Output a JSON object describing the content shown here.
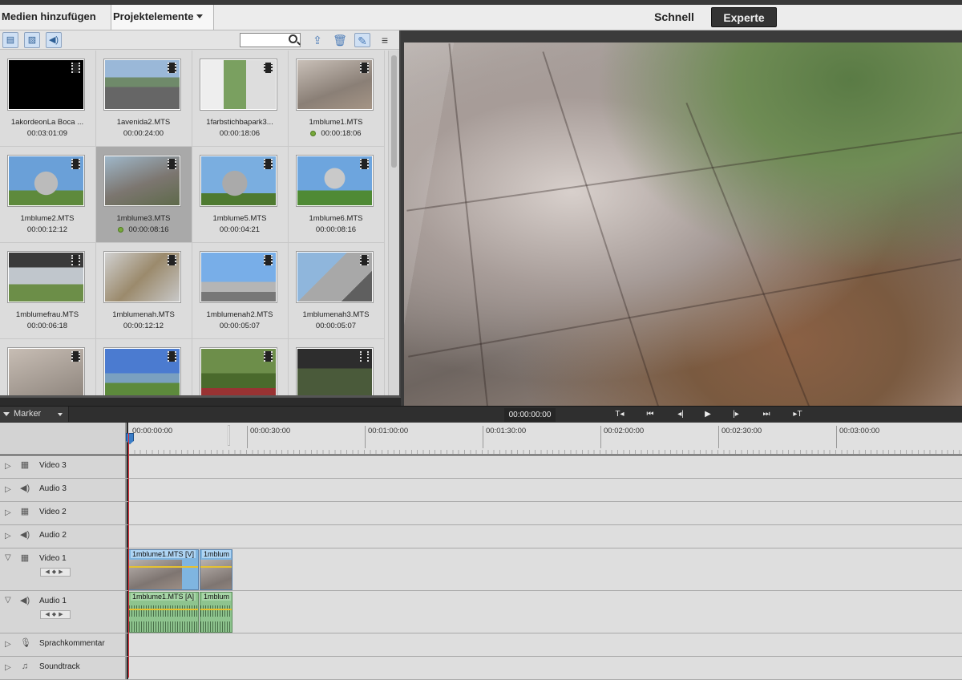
{
  "topbar": {
    "media_menu": "Medien hinzufügen",
    "project_menu": "Projektelemente",
    "mode_quick": "Schnell",
    "mode_expert": "Experte"
  },
  "assets": {
    "toolbar": {
      "filter_video": "video-filter-icon",
      "filter_image": "image-filter-icon",
      "filter_audio": "audio-filter-icon",
      "search_placeholder": ""
    },
    "items": [
      {
        "name": "1akordeonLa Boca ...",
        "duration": "00:03:01:09",
        "used": false
      },
      {
        "name": "1avenida2.MTS",
        "duration": "00:00:24:00",
        "used": false
      },
      {
        "name": "1farbstichbapark3...",
        "duration": "00:00:18:06",
        "used": false
      },
      {
        "name": "1mblume1.MTS",
        "duration": "00:00:18:06",
        "used": true
      },
      {
        "name": "1mblume2.MTS",
        "duration": "00:00:12:12",
        "used": false
      },
      {
        "name": "1mblume3.MTS",
        "duration": "00:00:08:16",
        "used": true
      },
      {
        "name": "1mblume5.MTS",
        "duration": "00:00:04:21",
        "used": false
      },
      {
        "name": "1mblume6.MTS",
        "duration": "00:00:08:16",
        "used": false
      },
      {
        "name": "1mblumefrau.MTS",
        "duration": "00:00:06:18",
        "used": false
      },
      {
        "name": "1mblumenah.MTS",
        "duration": "00:00:12:12",
        "used": false
      },
      {
        "name": "1mblumenah2.MTS",
        "duration": "00:00:05:07",
        "used": false
      },
      {
        "name": "1mblumenah3.MTS",
        "duration": "00:00:05:07",
        "used": false
      },
      {
        "name": "",
        "duration": "",
        "used": false
      },
      {
        "name": "",
        "duration": "",
        "used": false
      },
      {
        "name": "",
        "duration": "",
        "used": false
      },
      {
        "name": "",
        "duration": "",
        "used": false
      }
    ]
  },
  "timeline": {
    "marker_label": "Marker",
    "timecode": "00:00:00:00",
    "transport": [
      "T◂",
      "⏮",
      "◂|",
      "▶",
      "|▸",
      "⏭",
      "▸T"
    ],
    "ruler_labels": [
      "00:00:00:00",
      "00:00:30:00",
      "00:01:00:00",
      "00:01:30:00",
      "00:02:00:00",
      "00:02:30:00",
      "00:03:00:00"
    ],
    "tracks": [
      {
        "name": "Video 3",
        "kind": "video",
        "open": false
      },
      {
        "name": "Audio 3",
        "kind": "audio",
        "open": false
      },
      {
        "name": "Video 2",
        "kind": "video",
        "open": false
      },
      {
        "name": "Audio 2",
        "kind": "audio",
        "open": false
      },
      {
        "name": "Video 1",
        "kind": "video",
        "open": true
      },
      {
        "name": "Audio 1",
        "kind": "audio",
        "open": true
      },
      {
        "name": "Sprachkommentar",
        "kind": "mic",
        "open": false
      },
      {
        "name": "Soundtrack",
        "kind": "music",
        "open": false
      }
    ],
    "clips": {
      "video1_a": "1mblume1.MTS [V]",
      "video1_b": "1mblum",
      "audio1_a": "1mblume1.MTS [A]",
      "audio1_b": "1mblum"
    }
  }
}
